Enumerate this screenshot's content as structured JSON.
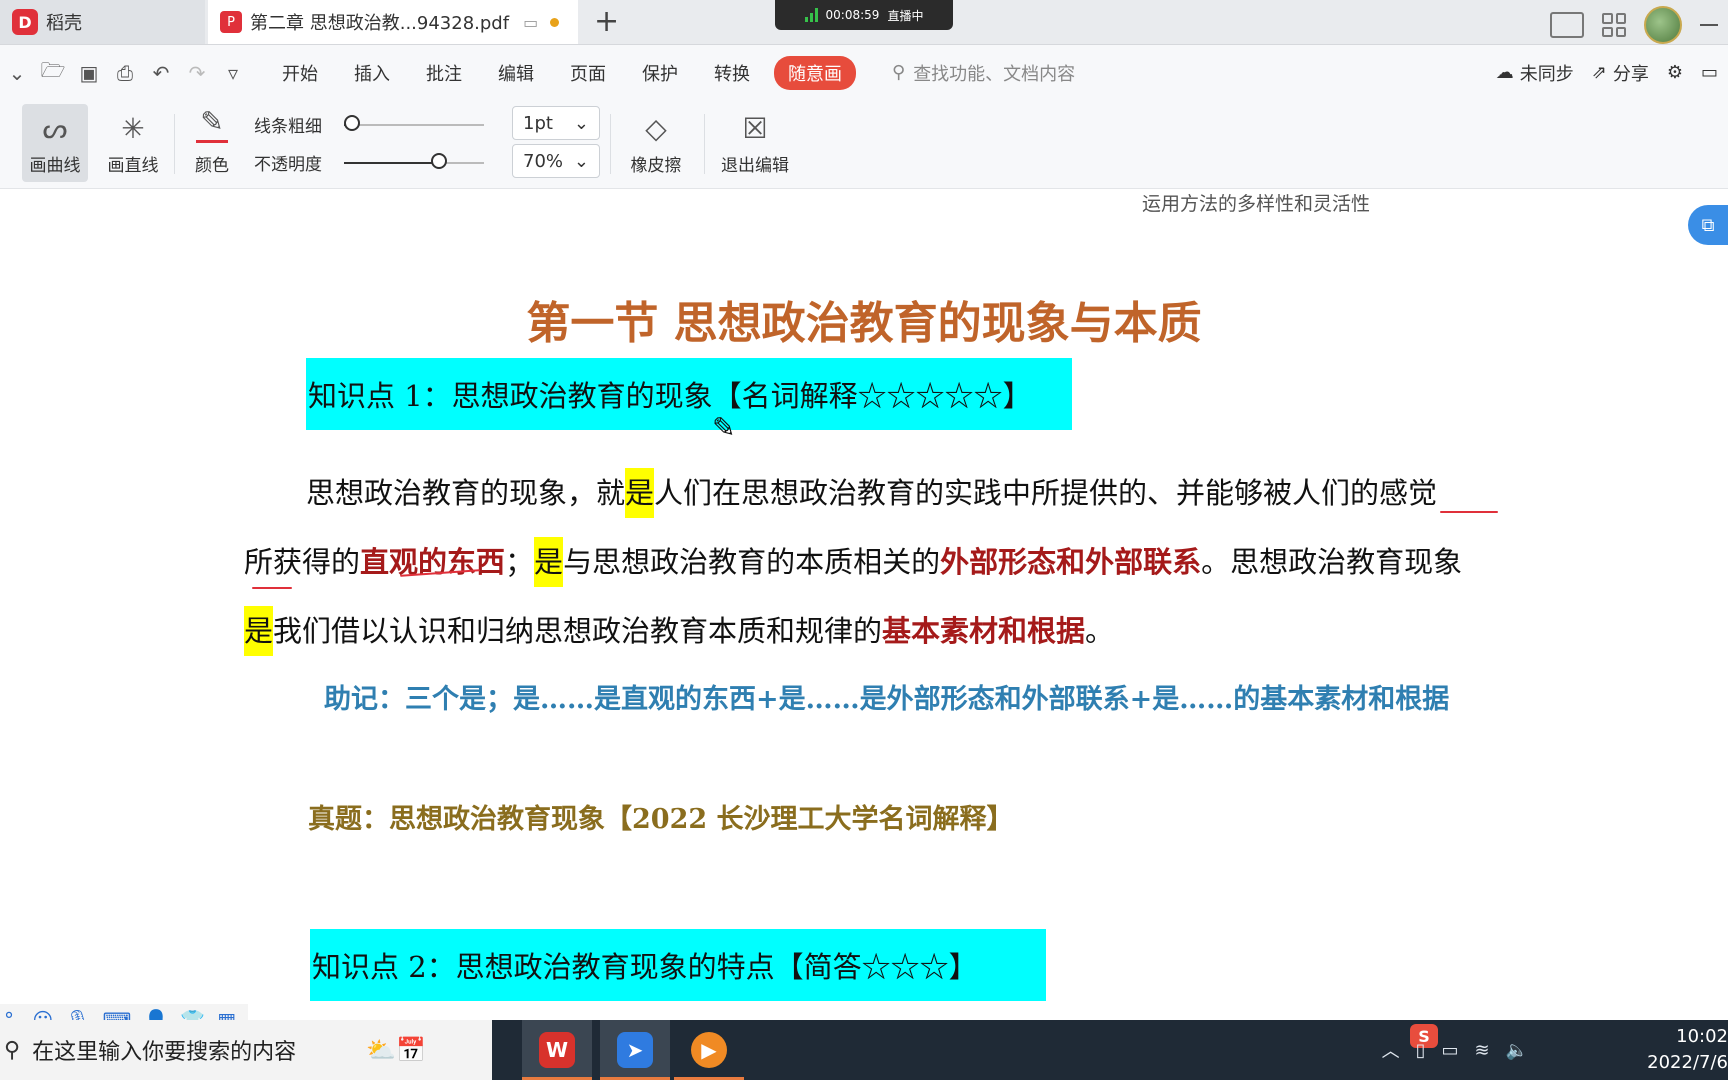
{
  "tabs": {
    "home_label": "稻壳",
    "doc_label": "第二章 思想政治教...94328.pdf",
    "new_tab": "+"
  },
  "live": {
    "time": "00:08:59",
    "status": "直播中"
  },
  "menu": {
    "items": [
      "开始",
      "插入",
      "批注",
      "编辑",
      "页面",
      "保护",
      "转换",
      "随意画"
    ],
    "search_placeholder": "查找功能、文档内容",
    "sync_label": "未同步",
    "share_label": "分享"
  },
  "toolbar": {
    "curve_label": "画曲线",
    "line_label": "画直线",
    "color_label": "颜色",
    "width_label": "线条粗细",
    "opacity_label": "不透明度",
    "width_value": "1pt",
    "opacity_value": "70%",
    "opacity_level": 0.7,
    "width_level": 0.0,
    "eraser_label": "橡皮擦",
    "exit_label": "退出编辑",
    "pen_color": "#e0303a"
  },
  "document": {
    "prev_line": "运用方法的多样性和灵活性",
    "title": "第一节  思想政治教育的现象与本质",
    "kp1": "知识点 1：思想政治教育的现象【名词解释☆☆☆☆☆】",
    "para": {
      "t1": "思想政治教育的现象，就",
      "h1": "是",
      "t2": "人们在思想政治教育的实践中所提供的、并能够被人们的感觉所获得的",
      "r1": "直观的东西",
      "t3": "；",
      "h2": "是",
      "t4": "与思想政治教育的本质相关的",
      "r2": "外部形态和外部联系",
      "t5": "。思想政治教育现象",
      "h3": "是",
      "t6": "我们借以认识和归纳思想政治教育本质和规律的",
      "r3": "基本素材和根据",
      "t7": "。"
    },
    "memo": "助记：三个是；是……是直观的东西+是……是外部形态和外部联系+是……的基本素材和根据",
    "exam": "真题：思想政治教育现象【2022 长沙理工大学名词解释】",
    "kp2": "知识点 2：思想政治教育现象的特点【简答☆☆☆】",
    "highlight_color": "#00ffff"
  },
  "taskbar": {
    "search_placeholder": "在这里输入你要搜索的内容",
    "time": "10:02",
    "date": "2022/7/6"
  }
}
